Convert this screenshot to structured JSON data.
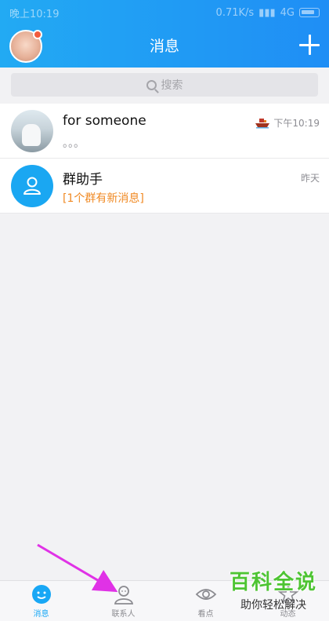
{
  "status_bar": {
    "time": "晚上10:19",
    "speed": "0.71K/s",
    "network": "4G"
  },
  "header": {
    "title": "消息"
  },
  "search": {
    "placeholder": "搜索"
  },
  "conversations": [
    {
      "name": "for someone",
      "preview": "。。。",
      "time": "下午10:19"
    },
    {
      "name": "群助手",
      "preview": "[1个群有新消息]",
      "time": "昨天"
    }
  ],
  "tabs": [
    {
      "label": "消息",
      "active": true
    },
    {
      "label": "联系人",
      "active": false
    },
    {
      "label": "看点",
      "active": false
    },
    {
      "label": "动态",
      "active": false
    }
  ],
  "watermark": {
    "title": "百科全说",
    "subtitle": "助你轻松解决"
  },
  "colors": {
    "accent": "#1f8ef5",
    "active_tab": "#18a7f5",
    "orange_text": "#f08a24",
    "arrow": "#e032e6",
    "watermark_green": "#4ec433"
  }
}
